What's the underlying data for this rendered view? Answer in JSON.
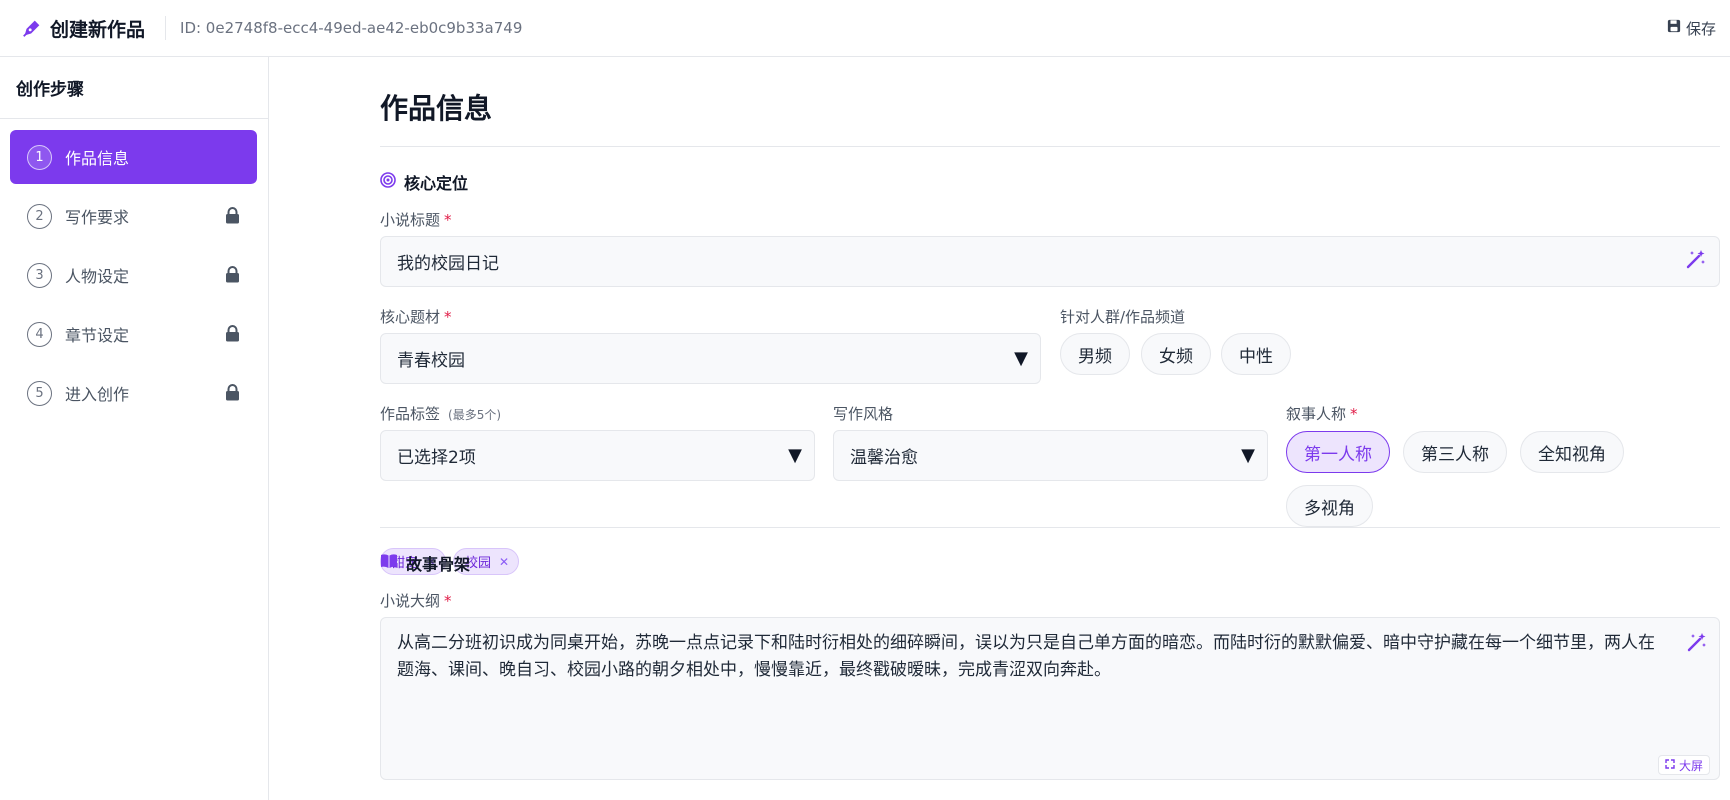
{
  "header": {
    "app_title": "创建新作品",
    "work_id": "ID: 0e2748f8-ecc4-49ed-ae42-eb0c9b33a749",
    "save_label": "保存"
  },
  "sidebar": {
    "title": "创作步骤",
    "steps": [
      {
        "num": "1",
        "label": "作品信息",
        "active": true,
        "locked": false
      },
      {
        "num": "2",
        "label": "写作要求",
        "active": false,
        "locked": true
      },
      {
        "num": "3",
        "label": "人物设定",
        "active": false,
        "locked": true
      },
      {
        "num": "4",
        "label": "章节设定",
        "active": false,
        "locked": true
      },
      {
        "num": "5",
        "label": "进入创作",
        "active": false,
        "locked": true
      }
    ]
  },
  "main": {
    "page_title": "作品信息",
    "core_section": {
      "title": "核心定位",
      "novel_title_label": "小说标题",
      "novel_title_value": "我的校园日记",
      "genre_label": "核心题材",
      "genre_value": "青春校园",
      "audience_label": "针对人群/作品频道",
      "audience_options": [
        "男频",
        "女频",
        "中性"
      ],
      "tags_label": "作品标签",
      "tags_hint": "(最多5个)",
      "tags_value": "已选择2项",
      "tags_selected": [
        "甜宠",
        "校园"
      ],
      "style_label": "写作风格",
      "style_value": "温馨治愈",
      "pov_label": "叙事人称",
      "pov_options": [
        "第一人称",
        "第三人称",
        "全知视角",
        "多视角"
      ],
      "pov_selected": "第一人称"
    },
    "story_section": {
      "title": "故事骨架",
      "outline_label": "小说大纲",
      "outline_value": "从高二分班初识成为同桌开始，苏晚一点点记录下和陆时衍相处的细碎瞬间，误以为只是自己单方面的暗恋。而陆时衍的默默偏爱、暗中守护藏在每一个细节里，两人在题海、课间、晚自习、校园小路的朝夕相处中，慢慢靠近，最终戳破暧昧，完成青涩双向奔赴。",
      "fullscreen_label": "大屏"
    },
    "required_mark": "*"
  },
  "colors": {
    "accent": "#7c3aed",
    "accent_light": "#ede4fd",
    "required": "#e11d48"
  }
}
